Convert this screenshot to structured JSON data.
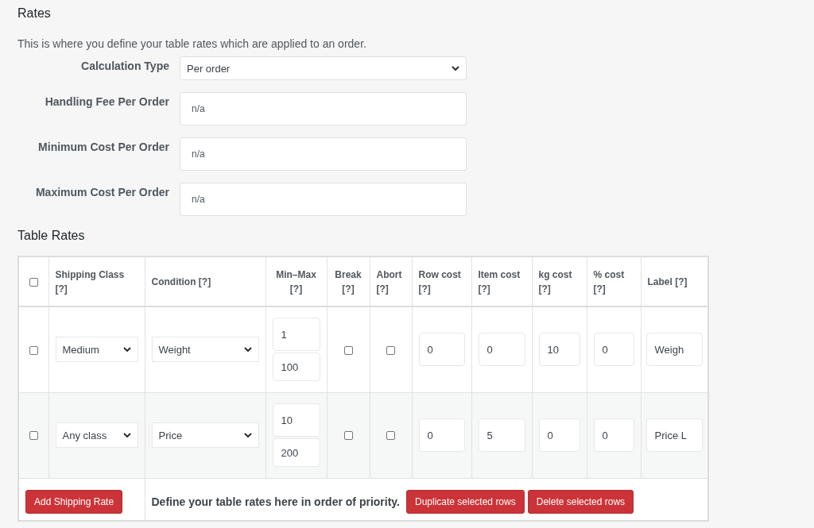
{
  "section_title": "Rates",
  "description": "This is where you define your table rates which are applied to an order.",
  "settings": [
    {
      "kind": "select",
      "label": "Calculation Type",
      "value": "Per order"
    },
    {
      "kind": "input",
      "label": "Handling Fee Per Order",
      "placeholder": "n/a"
    },
    {
      "kind": "input",
      "label": "Minimum Cost Per Order",
      "placeholder": "n/a"
    },
    {
      "kind": "input",
      "label": "Maximum Cost Per Order",
      "placeholder": "n/a"
    }
  ],
  "table_title": "Table Rates",
  "table": {
    "select_all_checked": false,
    "columns": [
      {
        "label": "Shipping Class",
        "help": "[?]"
      },
      {
        "label": "Condition",
        "help": "[?]"
      },
      {
        "label": "Min–Max",
        "help": "[?]"
      },
      {
        "label": "Break",
        "help": "[?]"
      },
      {
        "label": "Abort",
        "help": "[?]"
      },
      {
        "label": "Row cost",
        "help": "[?]"
      },
      {
        "label": "Item cost",
        "help": "[?]"
      },
      {
        "label": "kg cost",
        "help": "[?]"
      },
      {
        "label": "% cost",
        "help": "[?]"
      },
      {
        "label": "Label",
        "help": "[?]"
      }
    ],
    "rows": [
      {
        "selected": false,
        "shipping_class": "Medium",
        "condition": "Weight",
        "min": "1",
        "max": "100",
        "break": false,
        "abort": false,
        "row_cost": "0",
        "item_cost": "0",
        "kg_cost": "10",
        "percent_cost": "0",
        "label": "Weigh"
      },
      {
        "selected": false,
        "shipping_class": "Any class",
        "condition": "Price",
        "min": "10",
        "max": "200",
        "break": false,
        "abort": false,
        "row_cost": "0",
        "item_cost": "5",
        "kg_cost": "0",
        "percent_cost": "0",
        "label": "Price L"
      }
    ]
  },
  "footer": {
    "add_button": "Add Shipping Rate",
    "hint": "Define your table rates here in order of priority.",
    "buttons": [
      "Duplicate selected rows",
      "Delete selected rows"
    ]
  }
}
